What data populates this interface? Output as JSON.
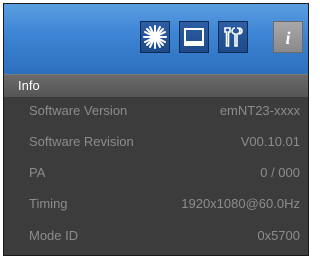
{
  "header": {
    "tabs": [
      {
        "icon": "brightness-icon",
        "active": false
      },
      {
        "icon": "monitor-icon",
        "active": false
      },
      {
        "icon": "tools-icon",
        "active": false
      },
      {
        "icon": "info-icon",
        "active": true,
        "glyph": "i"
      }
    ]
  },
  "section": {
    "title": "Info"
  },
  "rows": [
    {
      "label": "Software Version",
      "value": "emNT23-xxxx"
    },
    {
      "label": "Software Revision",
      "value": "V00.10.01"
    },
    {
      "label": "PA",
      "value": "0 / 000"
    },
    {
      "label": "Timing",
      "value": "1920x1080@60.0Hz"
    },
    {
      "label": "Mode ID",
      "value": "0x5700"
    }
  ],
  "colors": {
    "header_blue": "#3f86d6",
    "panel_bg": "#3c3c3c",
    "text_dim": "#8c8c8c",
    "text_white": "#ffffff"
  }
}
